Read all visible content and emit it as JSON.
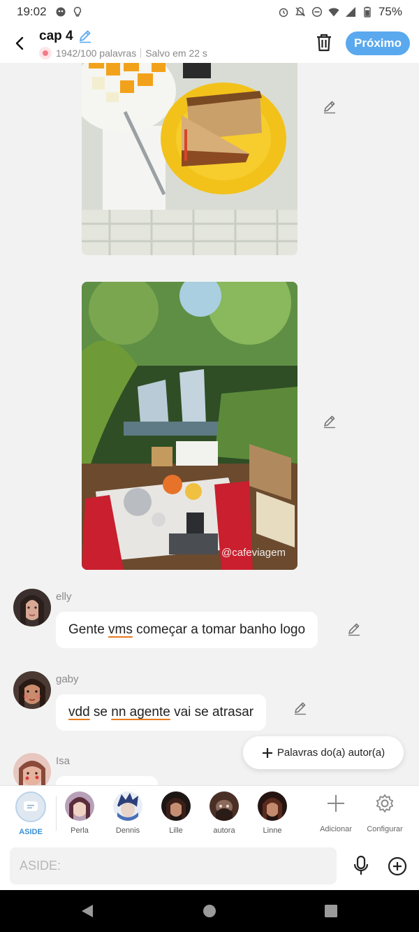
{
  "status_bar": {
    "time": "19:02",
    "battery": "75%",
    "left_icons": [
      "app-notification-icon",
      "lightbulb-icon"
    ],
    "right_icons": [
      "alarm-icon",
      "mute-icon",
      "do-not-disturb-icon",
      "wifi-icon",
      "signal-icon",
      "battery-icon"
    ]
  },
  "header": {
    "title": "cap 4",
    "word_count": "1942/100 palavras",
    "saved": "Salvo em 22 s",
    "next_label": "Próximo",
    "accent_color": "#5aa9ee"
  },
  "photos": [
    {
      "name": "food-photo",
      "watermark": ""
    },
    {
      "name": "waterfall-breakfast-photo",
      "watermark": "@cafeviagem"
    }
  ],
  "messages": [
    {
      "name": "elly",
      "segments": [
        {
          "t": "Gente "
        },
        {
          "t": "vms",
          "err": true
        },
        {
          "t": " começar a tomar banho logo"
        }
      ]
    },
    {
      "name": "gaby",
      "segments": [
        {
          "t": "vdd",
          "err": true
        },
        {
          "t": " se "
        },
        {
          "t": "nn agente",
          "err": true
        },
        {
          "t": " vai se atrasar"
        }
      ]
    },
    {
      "name": "Isa",
      "segments": []
    }
  ],
  "author_words_label": "Palavras do(a) autor(a)",
  "characters": [
    {
      "label": "ASIDE",
      "selected": true
    },
    {
      "label": "Perla"
    },
    {
      "label": "Dennis"
    },
    {
      "label": "Lille"
    },
    {
      "label": "autora"
    },
    {
      "label": "Linne"
    }
  ],
  "tools": {
    "add_label": "Adicionar",
    "settings_label": "Configurar"
  },
  "input": {
    "placeholder": "ASIDE:"
  }
}
